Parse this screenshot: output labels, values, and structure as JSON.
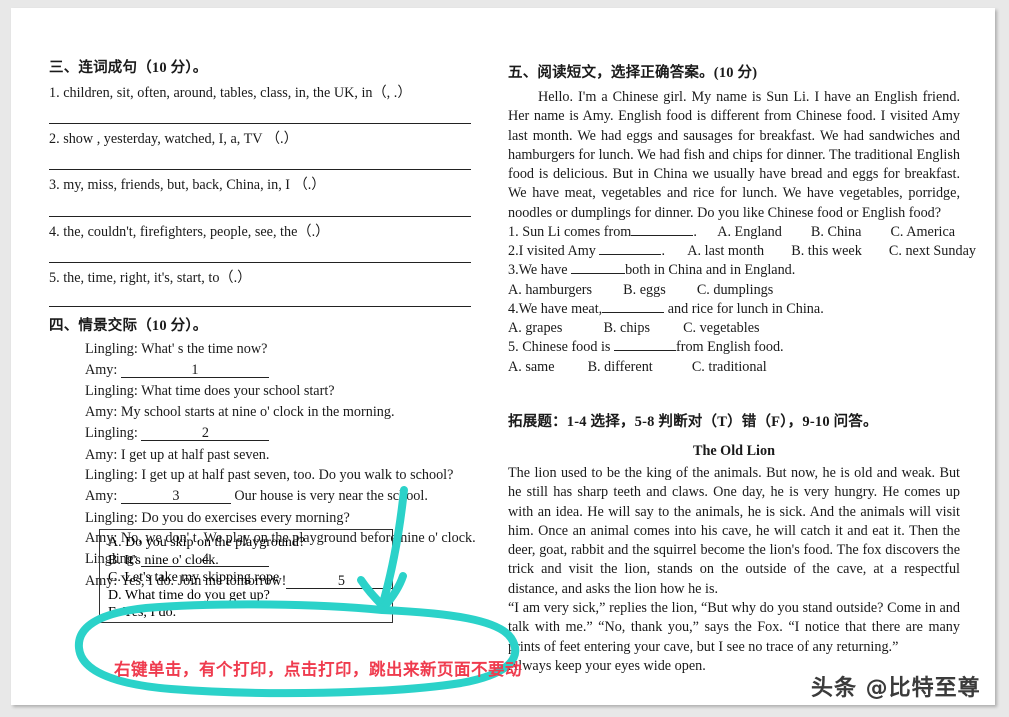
{
  "colors": {
    "page_bg": "#ffffff",
    "surround_bg": "#e8e8e8",
    "ink": "#1a1a1a",
    "annotation_teal": "#2bd2c9",
    "annotation_red": "#ef3b4e"
  },
  "left_column": {
    "section3": {
      "heading": "三、连词成句（10 分）。",
      "items": [
        "1. children, sit, often, around, tables, class, in, the UK, in（, .）",
        "2. show , yesterday, watched, I, a, TV  （.）",
        "3. my, miss, friends, but, back, China, in, I  （.）",
        "4. the, couldn't, firefighters, people, see, the（.）",
        "5.  the, time, right, it's, start, to（.）"
      ]
    },
    "section4": {
      "heading": "四、情景交际（10 分）。",
      "dialogue": [
        {
          "speaker": "Lingling:",
          "text": "What' s the time now?",
          "blank": null
        },
        {
          "speaker": " Amy:",
          "text": "",
          "blank": "1"
        },
        {
          "speaker": "Lingling:",
          "text": "What time does your school start?",
          "blank": null
        },
        {
          "speaker": "Amy:",
          "text": "My school starts at nine o' clock in the morning.",
          "blank": null
        },
        {
          "speaker": "Lingling:",
          "text": "",
          "blank": "2"
        },
        {
          "speaker": "Amy:",
          "text": "I get up at half past seven.",
          "blank": null
        },
        {
          "speaker": "Lingling:",
          "text": "I get up at half past seven, too. Do you walk to school?",
          "blank": null
        },
        {
          "speaker": "Amy:",
          "text": "Our house is very near the school.",
          "blank": "3"
        },
        {
          "speaker": "Lingling:",
          "text": "Do you do exercises every morning?",
          "blank": null
        },
        {
          "speaker": "Amy:",
          "text": "No, we don' t. We play on the playground before nine o' clock.",
          "blank": null
        },
        {
          "speaker": "Lingling:",
          "text": "",
          "blank": "4"
        },
        {
          "speaker": "Amy:",
          "text": "Yes, I do. Join me tomorrow!",
          "blank": "5"
        }
      ],
      "options": [
        "A. Do you skip on the playground?",
        "B. It's nine o' clock.",
        "C. Let's take my skipping rope",
        "D. What time do you get up?",
        "E. Yes, I do."
      ]
    }
  },
  "right_column": {
    "section5": {
      "heading": "五、阅读短文，选择正确答案。(10 分)",
      "passage": "Hello. I'm a Chinese girl. My name is Sun Li. I have an English friend. Her name is Amy. English food is different from Chinese food. I visited Amy last month. We had eggs and sausages for breakfast. We had sandwiches and hamburgers for lunch. We had fish and chips for dinner. The traditional English food is delicious. But in China we usually have bread and eggs for breakfast. We have meat, vegetables and rice for lunch. We have vegetables, porridge, noodles or dumplings for dinner. Do you like Chinese food or English food?",
      "questions": [
        {
          "stem_before": "1. Sun Li comes from",
          "stem_after": ".",
          "choices": [
            "A. England",
            "B. China",
            "C. America"
          ],
          "inline": true
        },
        {
          "stem_before": "2.I visited Amy",
          "stem_after": ".",
          "choices": [
            "A. last month",
            "B. this week",
            "C. next Sunday"
          ],
          "inline": true
        },
        {
          "stem_before": "3.We have",
          "stem_after": "both in China and in England.",
          "choices": [
            "A. hamburgers",
            "B. eggs",
            "C. dumplings"
          ],
          "inline": false
        },
        {
          "stem_before": "4.We have meat,",
          "stem_after": "and rice for lunch in China.",
          "choices": [
            "A. grapes",
            "B. chips",
            "C. vegetables"
          ],
          "inline": false
        },
        {
          "stem_before": "5. Chinese food is",
          "stem_after": "from English food.",
          "choices": [
            "A. same",
            "B. different",
            "C. traditional"
          ],
          "inline": false
        }
      ]
    },
    "extension": {
      "instruction": "拓展题：1-4 选择，5-8 判断对（T）错（F），9-10 问答。",
      "title": "The Old Lion",
      "paragraphs": [
        "The lion used to be the king of the animals. But now, he is old and weak. But he still has sharp teeth and claws. One day, he is very hungry. He comes up with an idea. He will say to the animals, he is sick. And the animals will visit him. Once an animal comes into his cave, he will catch it and eat it. Then the deer, goat, rabbit and the squirrel become the lion's food. The fox discovers the trick and visit the lion, stands on the outside of the cave, at a respectful distance, and asks the lion how he is.",
        "“I am very sick,” replies the lion, “But why do you stand outside? Come in and talk with me.” “No, thank you,” says the Fox. “I notice that there are many prints of feet entering your cave, but I see no trace of any returning.”",
        "Always keep your eyes wide open."
      ]
    }
  },
  "annotations": {
    "red_note": "右键单击，有个打印，点击打印，跳出来新页面不要动",
    "teal_shape": "down-arrow-and-ellipse"
  },
  "watermark": {
    "text": "头条 @比特至尊"
  }
}
